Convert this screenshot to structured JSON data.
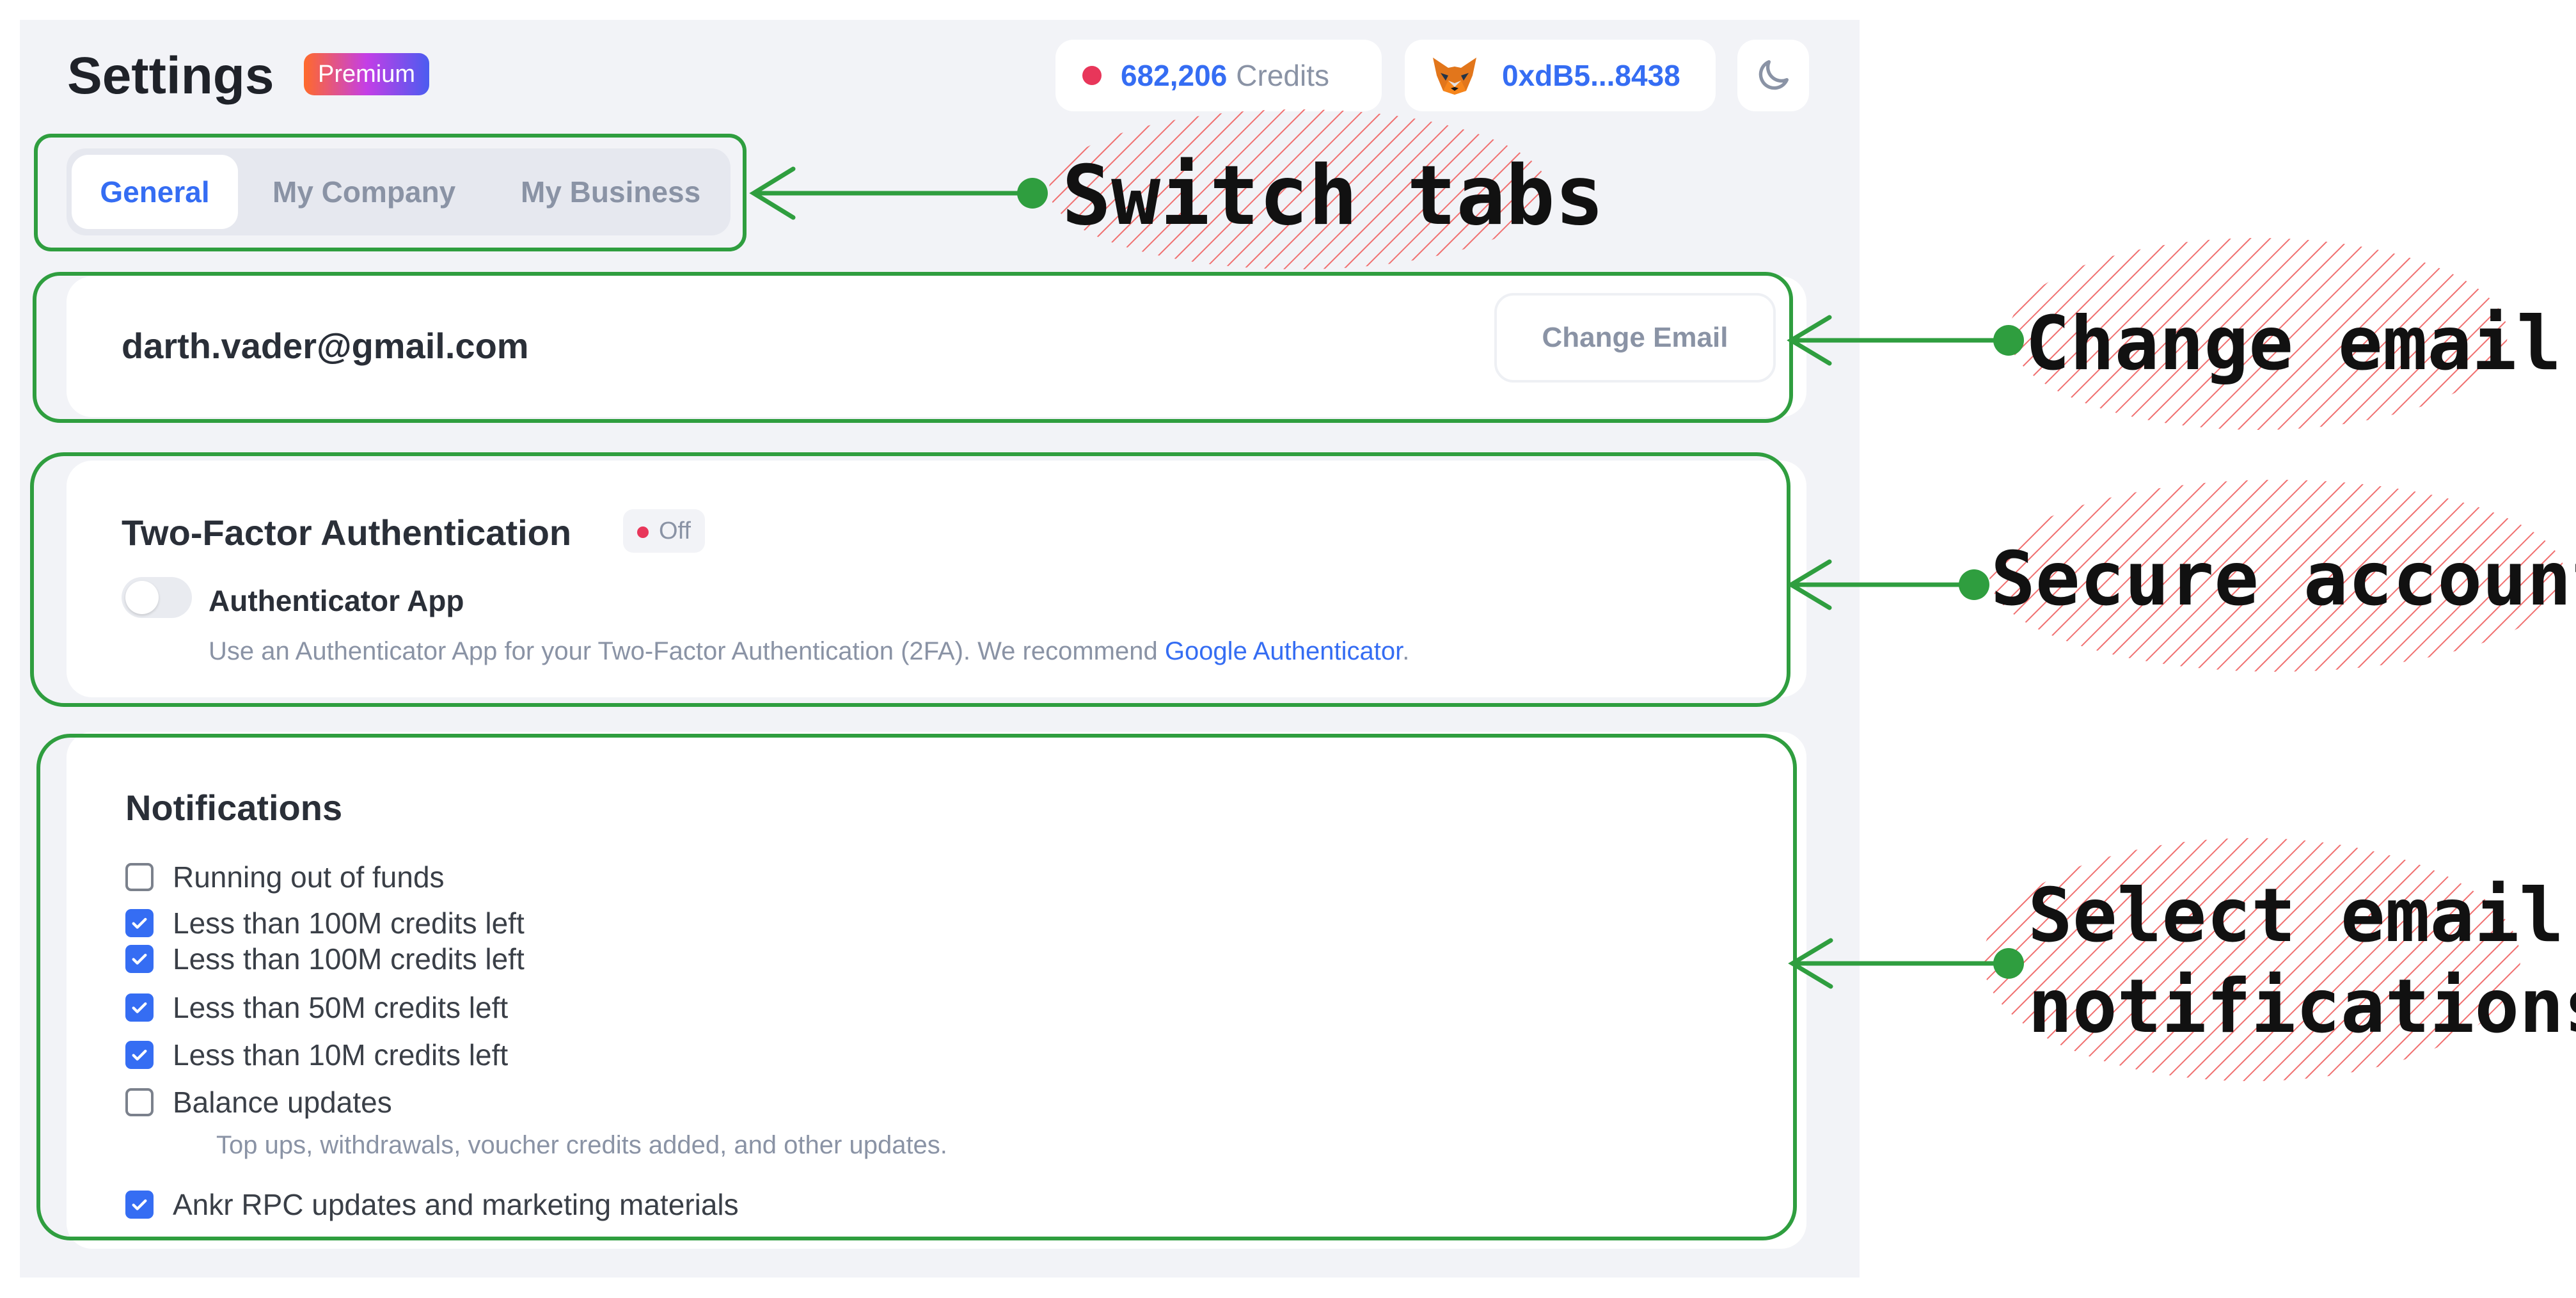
{
  "header": {
    "title": "Settings",
    "badge": "Premium",
    "credits_value": "682,206",
    "credits_label": "Credits",
    "wallet_address": "0xdB5...8438"
  },
  "tabs": [
    {
      "label": "General",
      "active": true
    },
    {
      "label": "My Company",
      "active": false
    },
    {
      "label": "My Business",
      "active": false
    }
  ],
  "email_section": {
    "email": "darth.vader@gmail.com",
    "change_button": "Change Email"
  },
  "two_factor": {
    "title": "Two-Factor Authentication",
    "status": "Off",
    "app_label": "Authenticator App",
    "toggle_on": false,
    "description": "Use an Authenticator App for your Two-Factor Authentication (2FA). We recommend ",
    "link_text": "Google Authenticator",
    "description_end": "."
  },
  "notifications": {
    "title": "Notifications",
    "items": [
      {
        "label": "Running out of funds",
        "checked": false
      },
      {
        "label": "Less than 100M credits left",
        "checked": true
      },
      {
        "label": "Less than 100M credits left",
        "checked": true
      },
      {
        "label": "Less than 50M credits left",
        "checked": true
      },
      {
        "label": "Less than 10M credits left",
        "checked": true
      },
      {
        "label": "Balance updates",
        "checked": false
      },
      {
        "label": "Ankr RPC updates and marketing materials",
        "checked": true
      }
    ],
    "balance_subtext": "Top ups, withdrawals, voucher credits added, and other updates."
  },
  "annotations": [
    {
      "text": "Switch tabs"
    },
    {
      "text": "Change email"
    },
    {
      "text": "Secure account"
    },
    {
      "text": "Select email"
    },
    {
      "text": "notifications"
    }
  ],
  "colors": {
    "accent": "#356df3",
    "status_red": "#e8365a",
    "annotation_green": "#2f9e3f",
    "annotation_hatch": "#f07070"
  }
}
